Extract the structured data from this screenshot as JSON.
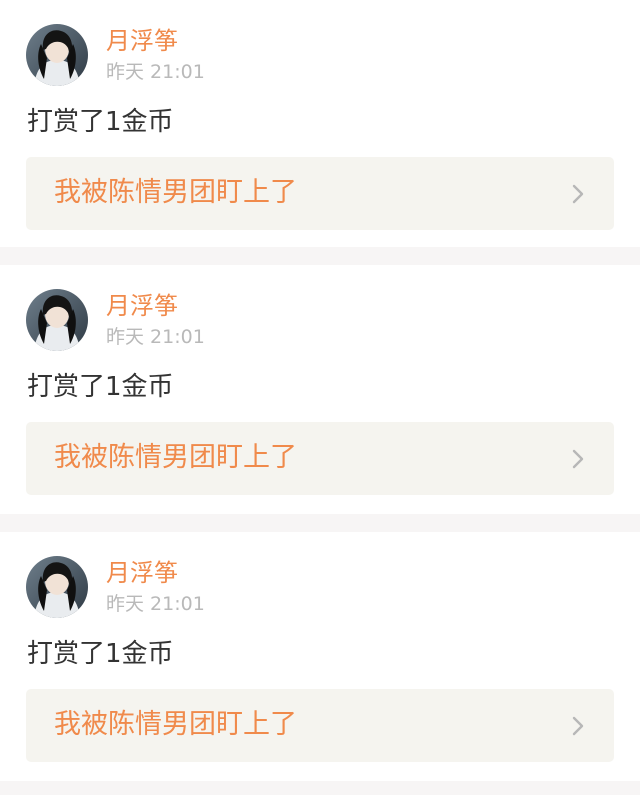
{
  "feed": {
    "items": [
      {
        "username": "月浮筝",
        "timestamp": "昨天 21:01",
        "message": "打赏了1金币",
        "link_title": "我被陈情男团盯上了",
        "avatar_icon": "user-avatar",
        "link_icon": "chevron-right-icon"
      },
      {
        "username": "月浮筝",
        "timestamp": "昨天 21:01",
        "message": "打赏了1金币",
        "link_title": "我被陈情男团盯上了",
        "avatar_icon": "user-avatar",
        "link_icon": "chevron-right-icon"
      },
      {
        "username": "月浮筝",
        "timestamp": "昨天 21:01",
        "message": "打赏了1金币",
        "link_title": "我被陈情男团盯上了",
        "avatar_icon": "user-avatar",
        "link_icon": "chevron-right-icon"
      }
    ]
  },
  "colors": {
    "accent": "#f08a4b",
    "timestamp": "#b9b9b9",
    "text": "#333333",
    "link_background": "#f5f4ef",
    "feed_background": "#f7f5f5"
  }
}
